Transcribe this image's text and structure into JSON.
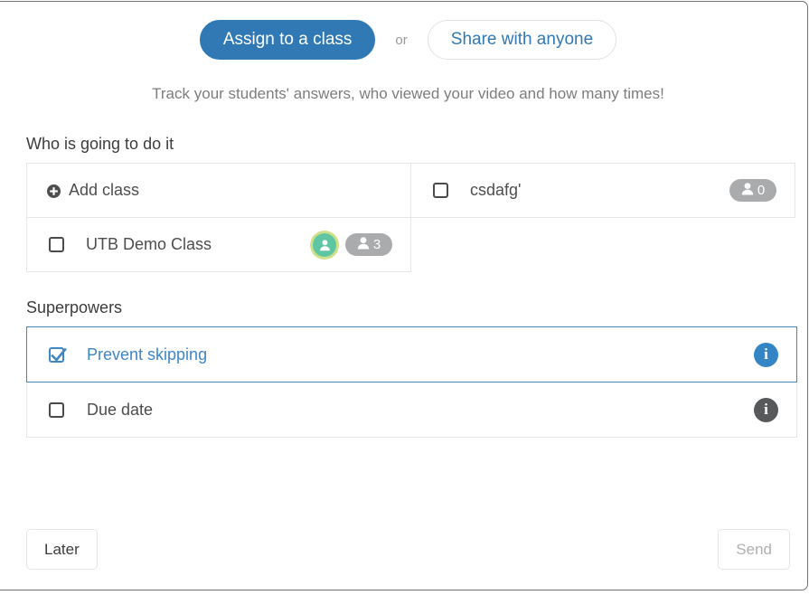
{
  "header": {
    "assign_label": "Assign to a class",
    "or_label": "or",
    "share_label": "Share with anyone",
    "subtitle": "Track your students' answers, who viewed your video and how many times!",
    "accent_color": "#3079b5"
  },
  "who_section": {
    "title": "Who is going to do it",
    "add_class_label": "Add class",
    "classes": [
      {
        "label": "csdafg'",
        "checked": false,
        "count": "0",
        "has_avatar": false
      },
      {
        "label": "UTB Demo Class",
        "checked": false,
        "count": "3",
        "has_avatar": true
      }
    ]
  },
  "superpowers_section": {
    "title": "Superpowers",
    "items": [
      {
        "label": "Prevent skipping",
        "checked": true,
        "info_color": "#3485c6",
        "info_glyph": "i"
      },
      {
        "label": "Due date",
        "checked": false,
        "info_color": "#58595b",
        "info_glyph": "i"
      }
    ]
  },
  "footer": {
    "later_label": "Later",
    "send_label": "Send"
  }
}
